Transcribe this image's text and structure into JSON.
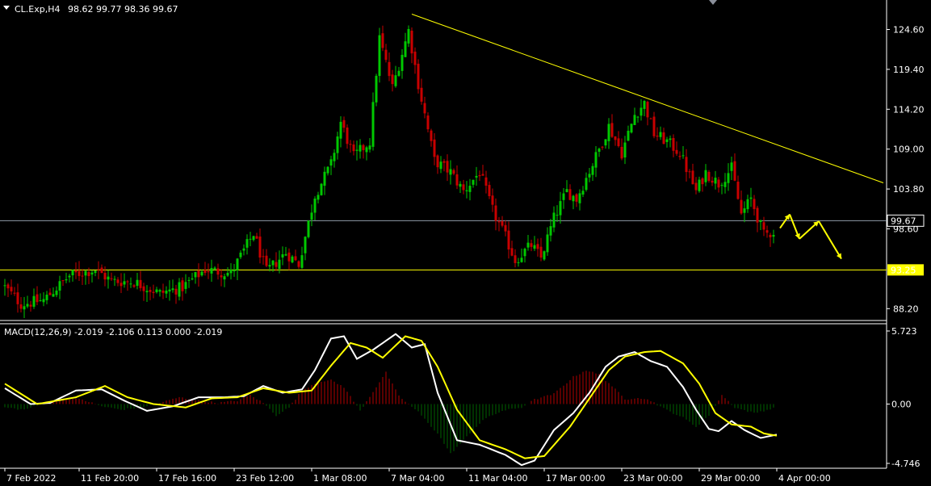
{
  "header": {
    "symbol_label": "CL.Exp,H4",
    "ohlc_label": "98.62 99.77 98.36 99.67"
  },
  "colors": {
    "background": "#000000",
    "axis": "#ffffff",
    "bull_candle": "#00c800",
    "bear_candle": "#c80000",
    "trendline": "#ffff00",
    "price_line": "#8f9aa8",
    "support_line": "#ffff00",
    "macd_line": "#ffffff",
    "signal_line": "#ffff00",
    "hist_pos": "#b40000",
    "hist_neg": "#006400",
    "arrow": "#ffff00"
  },
  "chart_data": [
    {
      "type": "candlestick",
      "symbol": "CL.Exp",
      "timeframe": "H4",
      "ylim": [
        84.0,
        127.3
      ],
      "y_ticks": [
        124.6,
        119.4,
        114.2,
        109.0,
        103.8,
        98.6,
        88.2
      ],
      "x_ticks": [
        {
          "label": "7 Feb 2022",
          "index": 0
        },
        {
          "label": "11 Feb 20:00",
          "index": 23
        },
        {
          "label": "17 Feb 16:00",
          "index": 47
        },
        {
          "label": "23 Feb 12:00",
          "index": 71
        },
        {
          "label": "1 Mar 08:00",
          "index": 95
        },
        {
          "label": "7 Mar 04:00",
          "index": 119
        },
        {
          "label": "11 Mar 04:00",
          "index": 143
        },
        {
          "label": "17 Mar 00:00",
          "index": 167
        },
        {
          "label": "23 Mar 00:00",
          "index": 191
        },
        {
          "label": "29 Mar 00:00",
          "index": 215
        },
        {
          "label": "4 Apr 00:00",
          "index": 239
        }
      ],
      "close_anchors": [
        [
          0,
          91.0
        ],
        [
          5,
          88.8
        ],
        [
          12,
          89.3
        ],
        [
          20,
          92.5
        ],
        [
          28,
          93.3
        ],
        [
          33,
          91.8
        ],
        [
          40,
          91.7
        ],
        [
          48,
          90.2
        ],
        [
          55,
          91.0
        ],
        [
          62,
          93.3
        ],
        [
          70,
          92.8
        ],
        [
          77,
          98.0
        ],
        [
          81,
          93.0
        ],
        [
          87,
          95.5
        ],
        [
          91,
          94.0
        ],
        [
          96,
          103.0
        ],
        [
          101,
          107.0
        ],
        [
          104,
          112.5
        ],
        [
          108,
          108.0
        ],
        [
          113,
          110.0
        ],
        [
          116,
          123.5
        ],
        [
          120,
          117.0
        ],
        [
          125,
          124.5
        ],
        [
          128,
          117.5
        ],
        [
          133,
          107.5
        ],
        [
          138,
          106.0
        ],
        [
          142,
          103.5
        ],
        [
          147,
          106.0
        ],
        [
          151,
          101.0
        ],
        [
          155,
          97.5
        ],
        [
          158,
          94.5
        ],
        [
          163,
          96.5
        ],
        [
          166,
          94.8
        ],
        [
          170,
          100.0
        ],
        [
          174,
          103.5
        ],
        [
          177,
          102.5
        ],
        [
          183,
          108.0
        ],
        [
          187,
          112.0
        ],
        [
          191,
          108.5
        ],
        [
          195,
          113.5
        ],
        [
          198,
          115.0
        ],
        [
          201,
          111.0
        ],
        [
          205,
          110.0
        ],
        [
          209,
          108.5
        ],
        [
          214,
          103.5
        ],
        [
          217,
          106.0
        ],
        [
          221,
          104.5
        ],
        [
          225,
          106.5
        ],
        [
          228,
          100.5
        ],
        [
          231,
          102.5
        ],
        [
          235,
          97.8
        ],
        [
          238,
          98.3
        ]
      ],
      "candle_count": 239,
      "last_price": 99.67,
      "support_level": 93.25,
      "price_labels": [
        {
          "text": "99.67",
          "value": 99.67
        },
        {
          "text": "93.25",
          "value": 93.25
        }
      ],
      "trendline": {
        "from": {
          "index": 126,
          "value": 126.6
        },
        "to": {
          "index": 272,
          "value": 104.6
        }
      },
      "projection_path": [
        {
          "index": 240,
          "value": 98.7
        },
        {
          "index": 243,
          "value": 100.5
        },
        {
          "index": 246,
          "value": 97.3
        },
        {
          "index": 252,
          "value": 99.6
        },
        {
          "index": 259,
          "value": 94.7
        }
      ]
    },
    {
      "type": "line",
      "indicator_label": "MACD(12,26,9) -2.019 -2.106 0.113 0.000 -2.019",
      "ylim": [
        -5.0,
        6.2
      ],
      "y_ticks": [
        5.723,
        0.0,
        -4.746
      ],
      "series": [
        {
          "anchors": [
            [
              0,
              1.4
            ],
            [
              8,
              0.0
            ],
            [
              14,
              0.1
            ],
            [
              22,
              1.2
            ],
            [
              30,
              1.3
            ],
            [
              37,
              0.3
            ],
            [
              44,
              -0.6
            ],
            [
              52,
              -0.2
            ],
            [
              60,
              0.6
            ],
            [
              68,
              0.6
            ],
            [
              74,
              0.7
            ],
            [
              80,
              1.6
            ],
            [
              86,
              1.0
            ],
            [
              92,
              1.3
            ],
            [
              96,
              3.0
            ],
            [
              101,
              5.8
            ],
            [
              105,
              6.0
            ],
            [
              109,
              4.0
            ],
            [
              114,
              4.8
            ],
            [
              118,
              5.6
            ],
            [
              121,
              6.2
            ],
            [
              126,
              5.0
            ],
            [
              130,
              5.3
            ],
            [
              134,
              1.0
            ],
            [
              140,
              -3.2
            ],
            [
              147,
              -3.6
            ],
            [
              155,
              -4.5
            ],
            [
              160,
              -5.4
            ],
            [
              164,
              -5.0
            ],
            [
              170,
              -2.3
            ],
            [
              176,
              -0.8
            ],
            [
              181,
              1.0
            ],
            [
              186,
              3.3
            ],
            [
              190,
              4.2
            ],
            [
              195,
              4.6
            ],
            [
              200,
              3.8
            ],
            [
              205,
              3.3
            ],
            [
              210,
              1.5
            ],
            [
              214,
              -0.5
            ],
            [
              218,
              -2.2
            ],
            [
              221,
              -2.4
            ],
            [
              225,
              -1.5
            ],
            [
              229,
              -2.3
            ],
            [
              234,
              -3.0
            ],
            [
              239,
              -2.7
            ]
          ]
        },
        {
          "anchors": [
            [
              0,
              1.8
            ],
            [
              10,
              0.0
            ],
            [
              22,
              0.6
            ],
            [
              31,
              1.6
            ],
            [
              38,
              0.6
            ],
            [
              46,
              0.0
            ],
            [
              56,
              -0.3
            ],
            [
              64,
              0.5
            ],
            [
              72,
              0.6
            ],
            [
              80,
              1.4
            ],
            [
              88,
              1.0
            ],
            [
              95,
              1.2
            ],
            [
              101,
              3.4
            ],
            [
              107,
              5.4
            ],
            [
              112,
              5.0
            ],
            [
              117,
              4.1
            ],
            [
              124,
              6.0
            ],
            [
              129,
              5.6
            ],
            [
              134,
              3.3
            ],
            [
              140,
              -0.5
            ],
            [
              147,
              -3.2
            ],
            [
              155,
              -4.0
            ],
            [
              161,
              -4.8
            ],
            [
              167,
              -4.6
            ],
            [
              175,
              -2.0
            ],
            [
              181,
              0.5
            ],
            [
              187,
              3.0
            ],
            [
              192,
              4.2
            ],
            [
              198,
              4.6
            ],
            [
              203,
              4.7
            ],
            [
              210,
              3.6
            ],
            [
              215,
              1.8
            ],
            [
              220,
              -0.8
            ],
            [
              225,
              -1.8
            ],
            [
              231,
              -2.0
            ],
            [
              235,
              -2.6
            ],
            [
              239,
              -2.8
            ]
          ]
        }
      ],
      "histogram_anchors": [
        [
          0,
          -0.3
        ],
        [
          6,
          -0.5
        ],
        [
          12,
          0.1
        ],
        [
          18,
          0.5
        ],
        [
          24,
          0.4
        ],
        [
          30,
          -0.2
        ],
        [
          36,
          -0.5
        ],
        [
          42,
          -0.3
        ],
        [
          48,
          0.1
        ],
        [
          54,
          0.6
        ],
        [
          60,
          0.3
        ],
        [
          66,
          0.1
        ],
        [
          72,
          0.3
        ],
        [
          76,
          0.8
        ],
        [
          80,
          0.1
        ],
        [
          84,
          -1.0
        ],
        [
          88,
          -0.3
        ],
        [
          92,
          1.2
        ],
        [
          97,
          2.0
        ],
        [
          101,
          2.1
        ],
        [
          105,
          1.5
        ],
        [
          110,
          -0.6
        ],
        [
          114,
          1.1
        ],
        [
          118,
          2.8
        ],
        [
          122,
          0.7
        ],
        [
          128,
          -0.7
        ],
        [
          134,
          -2.6
        ],
        [
          138,
          -4.4
        ],
        [
          142,
          -3.2
        ],
        [
          148,
          -1.4
        ],
        [
          154,
          -0.6
        ],
        [
          160,
          -0.3
        ],
        [
          164,
          0.4
        ],
        [
          170,
          0.9
        ],
        [
          176,
          2.4
        ],
        [
          180,
          3.0
        ],
        [
          184,
          2.6
        ],
        [
          188,
          1.6
        ],
        [
          192,
          0.4
        ],
        [
          196,
          0.6
        ],
        [
          200,
          0.3
        ],
        [
          204,
          -0.4
        ],
        [
          210,
          -1.2
        ],
        [
          214,
          -2.0
        ],
        [
          218,
          -1.0
        ],
        [
          222,
          0.8
        ],
        [
          226,
          -0.3
        ],
        [
          232,
          -0.8
        ],
        [
          239,
          -0.3
        ]
      ]
    }
  ]
}
